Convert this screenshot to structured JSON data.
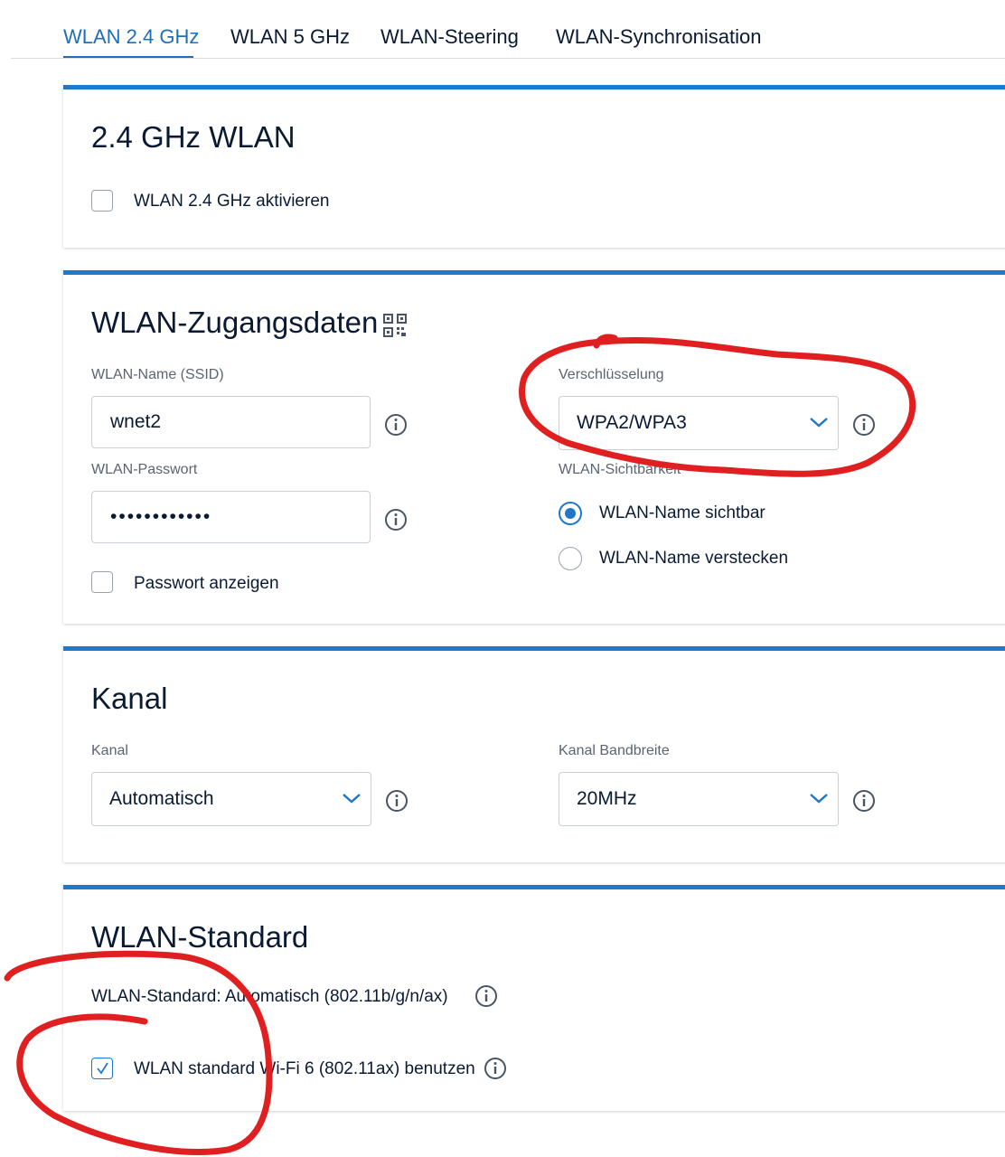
{
  "tabs": [
    {
      "label": "WLAN 2.4 GHz",
      "active": true
    },
    {
      "label": "WLAN 5 GHz",
      "active": false
    },
    {
      "label": "WLAN-Steering",
      "active": false
    },
    {
      "label": "WLAN-Synchronisation",
      "active": false
    }
  ],
  "section_wlan": {
    "title": "2.4 GHz WLAN",
    "activate_label": "WLAN 2.4 GHz aktivieren",
    "activate_checked": false
  },
  "section_credentials": {
    "title": "WLAN-Zugangsdaten",
    "qr_icon": "qr-code-icon",
    "ssid_label": "WLAN-Name (SSID)",
    "ssid_value": "wnet2",
    "password_label": "WLAN-Passwort",
    "password_value": "••••••••••••",
    "show_password_label": "Passwort anzeigen",
    "show_password_checked": false,
    "encryption_label": "Verschlüsselung",
    "encryption_value": "WPA2/WPA3",
    "visibility_label": "WLAN-Sichtbarkeit",
    "visibility_options": [
      {
        "label": "WLAN-Name sichtbar",
        "selected": true
      },
      {
        "label": "WLAN-Name verstecken",
        "selected": false
      }
    ]
  },
  "section_channel": {
    "title": "Kanal",
    "channel_label": "Kanal",
    "channel_value": "Automatisch",
    "bandwidth_label": "Kanal Bandbreite",
    "bandwidth_value": "20MHz"
  },
  "section_standard": {
    "title": "WLAN-Standard",
    "standard_text": "WLAN-Standard: Automatisch (802.11b/g/n/ax)",
    "wifi6_label": "WLAN standard Wi-Fi 6 (802.11ax) benutzen",
    "wifi6_checked": true
  },
  "colors": {
    "accent": "#1f78c8",
    "active_tab": "#1f6fb8",
    "annotation": "#e02020"
  }
}
